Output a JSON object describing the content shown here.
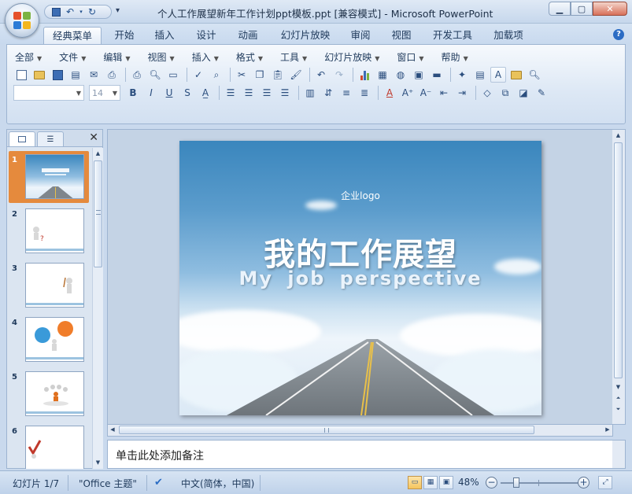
{
  "window": {
    "title": "个人工作展望新年工作计划ppt模板.ppt [兼容模式] - Microsoft PowerPoint"
  },
  "ribbon": {
    "tabs": [
      "经典菜单",
      "开始",
      "插入",
      "设计",
      "动画",
      "幻灯片放映",
      "审阅",
      "视图",
      "开发工具",
      "加载项"
    ],
    "active_tab": "经典菜单",
    "menus": [
      "全部",
      "文件",
      "编辑",
      "视图",
      "插入",
      "格式",
      "工具",
      "幻灯片放映",
      "窗口",
      "帮助"
    ],
    "font_name": "",
    "font_size": "14"
  },
  "slides_pane": {
    "numbers": [
      "1",
      "2",
      "3",
      "4",
      "5",
      "6"
    ],
    "selected": 1
  },
  "slide": {
    "logo_text": "企业logo",
    "title": "我的工作展望",
    "subtitle": "My job perspective"
  },
  "notes": {
    "placeholder": "单击此处添加备注"
  },
  "status": {
    "slide_info": "幻灯片 1/7",
    "theme": "\"Office 主题\"",
    "language": "中文(简体，中国)",
    "zoom_percent": "48%",
    "zoom_level": 0.48
  },
  "colors": {
    "accent_selected": "#e58a3d",
    "ribbon_blue": "#dde8f5"
  }
}
